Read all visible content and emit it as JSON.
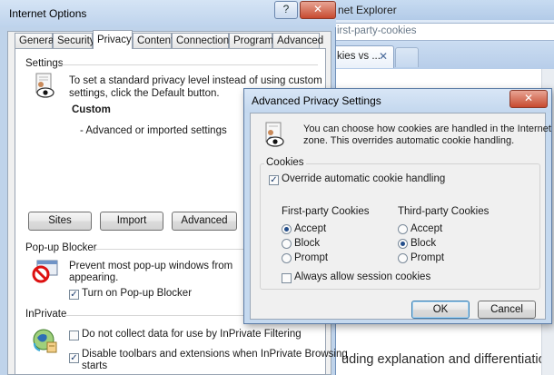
{
  "browser": {
    "title": "net Explorer",
    "address_text": "irst-party-cookies",
    "tab_label": "kies vs ...",
    "tab_close": "✕",
    "page_text": "uding explanation and differentiation betwee"
  },
  "internet_options": {
    "title": "Internet Options",
    "help_button": "?",
    "close_button": "✕",
    "tabs": [
      "General",
      "Security",
      "Privacy",
      "Content",
      "Connections",
      "Programs",
      "Advanced"
    ],
    "active_tab": "Privacy",
    "settings": {
      "header": "Settings",
      "description_line1": "To set a standard privacy level instead of using custom",
      "description_line2": "settings, click the Default button.",
      "level_name": "Custom",
      "level_detail": "- Advanced or imported settings",
      "buttons": {
        "sites": "Sites",
        "import": "Import",
        "advanced": "Advanced"
      }
    },
    "popup_blocker": {
      "header": "Pop-up Blocker",
      "description_line1": "Prevent most pop-up windows from",
      "description_line2": "appearing.",
      "turn_on_label": "Turn on Pop-up Blocker",
      "turn_on_checked": true
    },
    "inprivate": {
      "header": "InPrivate",
      "no_collect_label": "Do not collect data for use by InPrivate Filtering",
      "no_collect_checked": false,
      "disable_toolbars_line1": "Disable toolbars and extensions when InPrivate Browsing",
      "disable_toolbars_line2": "starts",
      "disable_toolbars_checked": true
    }
  },
  "advanced_privacy": {
    "title": "Advanced Privacy Settings",
    "close_button": "✕",
    "description_line1": "You can choose how cookies are handled in the Internet",
    "description_line2": "zone.  This overrides automatic cookie handling.",
    "cookies_group": "Cookies",
    "override_label": "Override automatic cookie handling",
    "override_checked": true,
    "first_party": {
      "header": "First-party Cookies",
      "options": [
        "Accept",
        "Block",
        "Prompt"
      ],
      "selected": "Accept"
    },
    "third_party": {
      "header": "Third-party Cookies",
      "options": [
        "Accept",
        "Block",
        "Prompt"
      ],
      "selected": "Block"
    },
    "session_label": "Always allow session cookies",
    "session_checked": false,
    "ok_button": "OK",
    "cancel_button": "Cancel"
  },
  "colors": {
    "title_bar": "#bed3ec",
    "close_button": "#c74a2f",
    "radio_dot": "#234d8a"
  }
}
